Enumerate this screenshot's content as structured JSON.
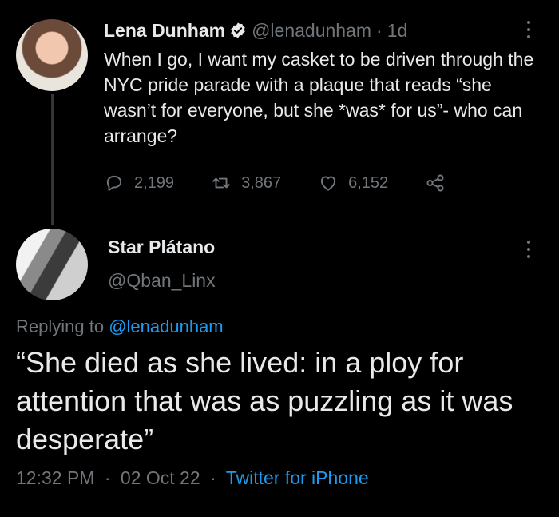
{
  "original_tweet": {
    "name": "Lena Dunham",
    "handle": "@lenadunham",
    "separator": "·",
    "time_ago": "1d",
    "text": "When I go, I want my casket to be driven through the NYC pride parade with a plaque that reads “she wasn’t for everyone, but she *was* for us”- who can arrange?",
    "replies": "2,199",
    "retweets": "3,867",
    "likes": "6,152"
  },
  "reply_tweet": {
    "name": "Star Plátano",
    "handle": "@Qban_Linx",
    "replying_prefix": "Replying to",
    "replying_handle": "@lenadunham",
    "text": "“She died as she lived: in a ploy for attention that was as puzzling as it was desperate”",
    "time": "12:32 PM",
    "separator": "·",
    "date": "02 Oct 22",
    "source": "Twitter for iPhone"
  },
  "colors": {
    "background": "#000000",
    "text": "#e7e9ea",
    "muted": "#71767b",
    "link": "#1d9bf0",
    "verified": "#1d9bf0"
  }
}
